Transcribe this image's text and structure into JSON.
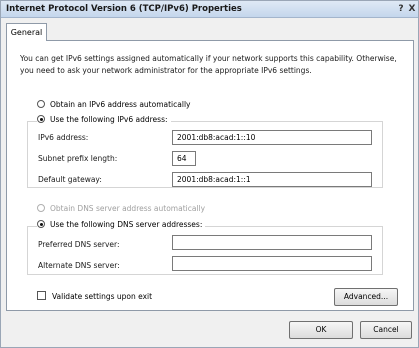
{
  "window": {
    "title": "Internet Protocol Version 6 (TCP/IPv6) Properties",
    "help_label": "?",
    "close_label": "X"
  },
  "tabs": [
    {
      "label": "General",
      "active": true
    }
  ],
  "description": "You can get IPv6 settings assigned automatically if your network supports this capability. Otherwise, you need to ask your network administrator for the appropriate IPv6 settings.",
  "ip_settings": {
    "auto_option": {
      "label": "Obtain an IPv6 address automatically",
      "selected": false
    },
    "manual_option": {
      "label": "Use the following IPv6 address:",
      "selected": true
    },
    "address": {
      "label": "IPv6 address:",
      "value": "2001:db8:acad:1::10"
    },
    "prefix_length": {
      "label": "Subnet prefix length:",
      "value": "64"
    },
    "gateway": {
      "label": "Default gateway:",
      "value": "2001:db8:acad:1::1"
    }
  },
  "dns_settings": {
    "auto_option": {
      "label": "Obtain DNS server address automatically",
      "selected": false,
      "enabled": false
    },
    "manual_option": {
      "label": "Use the following DNS server addresses:",
      "selected": true
    },
    "preferred": {
      "label": "Preferred DNS server:",
      "value": ""
    },
    "alternate": {
      "label": "Alternate DNS server:",
      "value": ""
    }
  },
  "validate": {
    "label": "Validate settings upon exit",
    "checked": false
  },
  "buttons": {
    "advanced": "Advanced...",
    "ok": "OK",
    "cancel": "Cancel"
  }
}
